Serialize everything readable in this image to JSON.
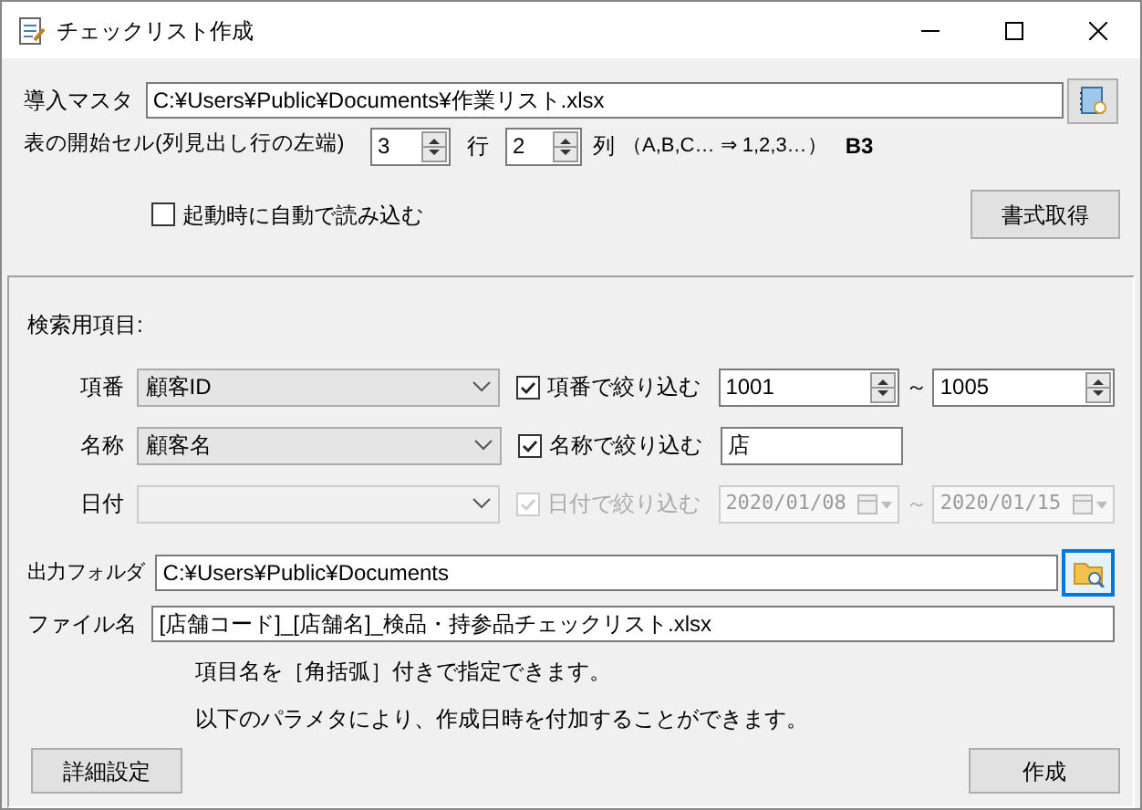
{
  "window": {
    "title": "チェックリスト作成"
  },
  "master": {
    "label": "導入マスタ",
    "value": "C:¥Users¥Public¥Documents¥作業リスト.xlsx"
  },
  "start_cell": {
    "label": "表の開始セル(列見出し行の左端)",
    "row_value": "3",
    "row_unit": "行",
    "col_value": "2",
    "col_unit": "列",
    "hint": "（A,B,C… ⇒ 1,2,3…）",
    "result": "B3"
  },
  "auto_load": {
    "label": "起動時に自動で読み込む",
    "checked": false
  },
  "format_button": "書式取得",
  "search": {
    "heading": "検索用項目:",
    "rows": [
      {
        "kind": "range",
        "label": "項番",
        "column": "顧客ID",
        "filter_label": "項番で絞り込む",
        "checked": true,
        "disabled": false,
        "from": "1001",
        "to": "1005",
        "separator": "～"
      },
      {
        "kind": "text",
        "label": "名称",
        "column": "顧客名",
        "filter_label": "名称で絞り込む",
        "checked": true,
        "disabled": false,
        "value": "店"
      },
      {
        "kind": "date",
        "label": "日付",
        "filter_label": "日付で絞り込む",
        "checked": true,
        "disabled": true,
        "from": "2020/01/08",
        "to": "2020/01/15",
        "separator": "～"
      }
    ]
  },
  "output_folder": {
    "label": "出力フォルダ",
    "value": "C:¥Users¥Public¥Documents"
  },
  "file_name": {
    "label": "ファイル名",
    "value": "[店舗コード]_[店舗名]_検品・持参品チェックリスト.xlsx"
  },
  "help": [
    "項目名を［角括弧］付きで指定できます。",
    "以下のパラメタにより、作成日時を付加することができます。"
  ],
  "buttons": {
    "details": "詳細設定",
    "create": "作成"
  }
}
